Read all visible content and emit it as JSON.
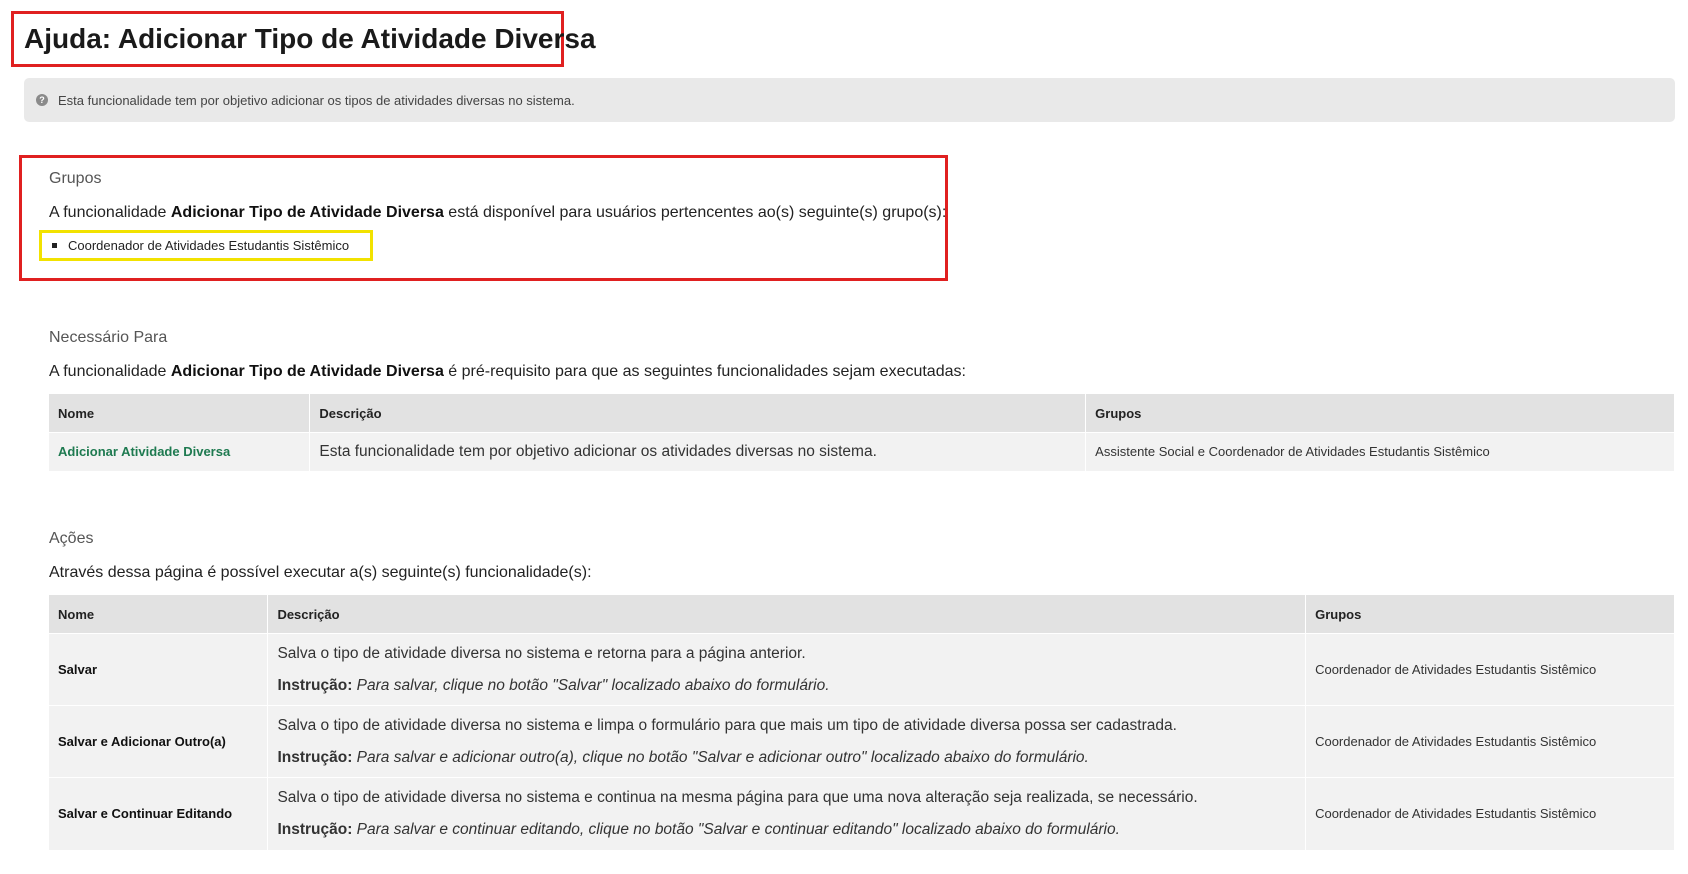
{
  "page": {
    "title": "Ajuda: Adicionar Tipo de Atividade Diversa",
    "info_text": "Esta funcionalidade tem por objetivo adicionar os tipos de atividades diversas no sistema."
  },
  "grupos": {
    "heading": "Grupos",
    "text_before": "A funcionalidade ",
    "func_name": "Adicionar Tipo de Atividade Diversa",
    "text_after": " está disponível para usuários pertencentes ao(s) seguinte(s) grupo(s):",
    "items": [
      "Coordenador de Atividades Estudantis Sistêmico"
    ]
  },
  "necessario": {
    "heading": "Necessário Para",
    "text_before": "A funcionalidade ",
    "func_name": "Adicionar Tipo de Atividade Diversa",
    "text_after": " é pré-requisito para que as seguintes funcionalidades sejam executadas:",
    "columns": [
      "Nome",
      "Descrição",
      "Grupos"
    ],
    "rows": [
      {
        "nome": "Adicionar Atividade Diversa",
        "descricao": "Esta funcionalidade tem por objetivo adicionar os atividades diversas no sistema.",
        "grupos": "Assistente Social e Coordenador de Atividades Estudantis Sistêmico"
      }
    ]
  },
  "acoes": {
    "heading": "Ações",
    "intro": "Através dessa página é possível executar a(s) seguinte(s) funcionalidade(s):",
    "columns": [
      "Nome",
      "Descrição",
      "Grupos"
    ],
    "instr_label": "Instrução:",
    "rows": [
      {
        "nome": "Salvar",
        "descricao": "Salva o tipo de atividade diversa no sistema e retorna para a página anterior.",
        "instrucao": " Para salvar, clique no botão \"Salvar\" localizado abaixo do formulário.",
        "grupos": "Coordenador de Atividades Estudantis Sistêmico"
      },
      {
        "nome": "Salvar e Adicionar Outro(a)",
        "descricao": "Salva o tipo de atividade diversa no sistema e limpa o formulário para que mais um tipo de atividade diversa possa ser cadastrada.",
        "instrucao": " Para salvar e adicionar outro(a), clique no botão \"Salvar e adicionar outro\" localizado abaixo do formulário.",
        "grupos": "Coordenador de Atividades Estudantis Sistêmico"
      },
      {
        "nome": "Salvar e Continuar Editando",
        "descricao": "Salva o tipo de atividade diversa no sistema e continua na mesma página para que uma nova alteração seja realizada, se necessário.",
        "instrucao": " Para salvar e continuar editando, clique no botão \"Salvar e continuar editando\" localizado abaixo do formulário.",
        "grupos": "Coordenador de Atividades Estudantis Sistêmico"
      }
    ]
  },
  "colors": {
    "highlight_red": "#e02020",
    "highlight_yellow": "#f2e200",
    "link_green": "#1e7a50"
  }
}
